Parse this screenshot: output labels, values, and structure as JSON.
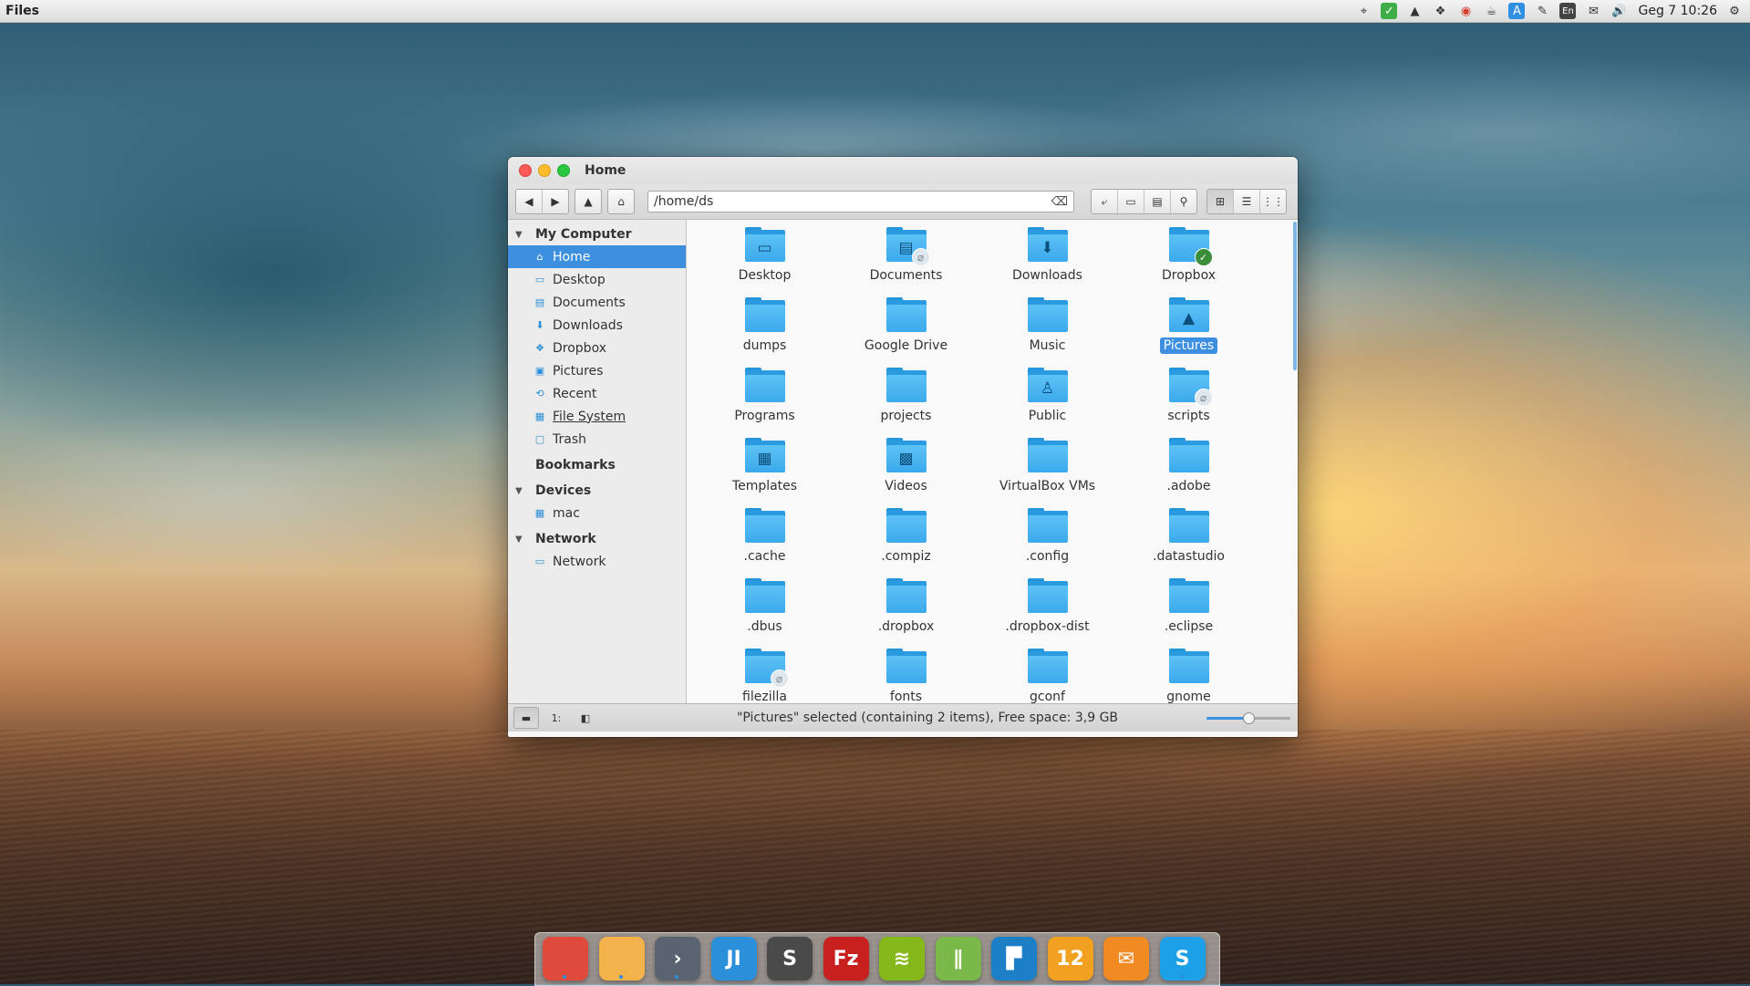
{
  "topbar": {
    "app_name": "Files",
    "clock": "Geg 7 10:26",
    "tray_icons": [
      {
        "name": "network-icon",
        "glyph": "⌖"
      },
      {
        "name": "check-icon",
        "glyph": "✓"
      },
      {
        "name": "google-drive-icon",
        "glyph": "▲"
      },
      {
        "name": "dropbox-icon",
        "glyph": "❖"
      },
      {
        "name": "chrome-icon",
        "glyph": "◉"
      },
      {
        "name": "caffeine-icon",
        "glyph": "☕"
      },
      {
        "name": "app-store-icon",
        "glyph": "A"
      },
      {
        "name": "pen-icon",
        "glyph": "✎"
      },
      {
        "name": "keyboard-layout-icon",
        "glyph": "En"
      },
      {
        "name": "mail-icon",
        "glyph": "✉"
      },
      {
        "name": "volume-icon",
        "glyph": "🔊"
      }
    ],
    "settings_glyph": "⚙"
  },
  "window": {
    "title": "Home",
    "path": "/home/ds",
    "clear_glyph": "⌫"
  },
  "toolbar": {
    "back": "◀",
    "forward": "▶",
    "up": "▲",
    "home": "⌂",
    "right_buttons": [
      "⤶",
      "▭",
      "▤",
      "⚲"
    ],
    "view_buttons": [
      "⊞",
      "☰",
      "⋮⋮"
    ]
  },
  "sidebar": {
    "my_computer": "My Computer",
    "items": [
      {
        "label": "Home",
        "icon": "⌂"
      },
      {
        "label": "Desktop",
        "icon": "▭"
      },
      {
        "label": "Documents",
        "icon": "▤"
      },
      {
        "label": "Downloads",
        "icon": "⬇"
      },
      {
        "label": "Dropbox",
        "icon": "❖"
      },
      {
        "label": "Pictures",
        "icon": "▣"
      },
      {
        "label": "Recent",
        "icon": "⟲"
      },
      {
        "label": "File System",
        "icon": "▦"
      },
      {
        "label": "Trash",
        "icon": "▢"
      }
    ],
    "bookmarks": "Bookmarks",
    "devices": "Devices",
    "device_items": [
      {
        "label": "mac",
        "icon": "▦"
      }
    ],
    "network": "Network",
    "network_items": [
      {
        "label": "Network",
        "icon": "▭"
      }
    ]
  },
  "files": [
    {
      "name": "Desktop",
      "glyph": "▭"
    },
    {
      "name": "Documents",
      "glyph": "▤",
      "badge": "link"
    },
    {
      "name": "Downloads",
      "glyph": "⬇"
    },
    {
      "name": "Dropbox",
      "badge": "ok"
    },
    {
      "name": "dumps"
    },
    {
      "name": "Google Drive"
    },
    {
      "name": "Music"
    },
    {
      "name": "Pictures",
      "glyph": "▲",
      "selected": true
    },
    {
      "name": "Programs"
    },
    {
      "name": "projects"
    },
    {
      "name": "Public",
      "glyph": "♙"
    },
    {
      "name": "scripts",
      "badge": "link"
    },
    {
      "name": "Templates",
      "glyph": "▦"
    },
    {
      "name": "Videos",
      "glyph": "▩"
    },
    {
      "name": "VirtualBox VMs"
    },
    {
      "name": ".adobe"
    },
    {
      "name": ".cache"
    },
    {
      "name": ".compiz"
    },
    {
      "name": ".config"
    },
    {
      "name": ".datastudio"
    },
    {
      "name": ".dbus"
    },
    {
      "name": ".dropbox"
    },
    {
      "name": ".dropbox-dist"
    },
    {
      "name": ".eclipse"
    },
    {
      "name": "filezilla",
      "badge": "link"
    },
    {
      "name": "fonts"
    },
    {
      "name": "gconf"
    },
    {
      "name": "gnome"
    }
  ],
  "statusbar": {
    "text": "\"Pictures\" selected (containing 2 items), Free space: 3,9 GB",
    "buttons": [
      "▬",
      "1:",
      "◧"
    ],
    "zoom_level": 0.5
  },
  "dock": [
    {
      "name": "chrome-app",
      "label": "",
      "color": "#e04a3a"
    },
    {
      "name": "files-app",
      "label": "",
      "color": "#f4b24a"
    },
    {
      "name": "terminal-app",
      "label": "›",
      "color": "#5a6470"
    },
    {
      "name": "intellij-app",
      "label": "JI",
      "color": "#2c8fd9"
    },
    {
      "name": "sublime-app",
      "label": "S",
      "color": "#4a4a4a"
    },
    {
      "name": "filezilla-app",
      "label": "Fz",
      "color": "#c8201e"
    },
    {
      "name": "spotify-app",
      "label": "≋",
      "color": "#85b81a"
    },
    {
      "name": "feedly-app",
      "label": "∥",
      "color": "#7ab84a"
    },
    {
      "name": "trello-app",
      "label": "▛",
      "color": "#1d7fc6"
    },
    {
      "name": "calendar-app",
      "label": "12",
      "color": "#f1a020"
    },
    {
      "name": "mail-app",
      "label": "✉",
      "color": "#f28a24"
    },
    {
      "name": "skype-app",
      "label": "S",
      "color": "#1ea0e6"
    }
  ]
}
